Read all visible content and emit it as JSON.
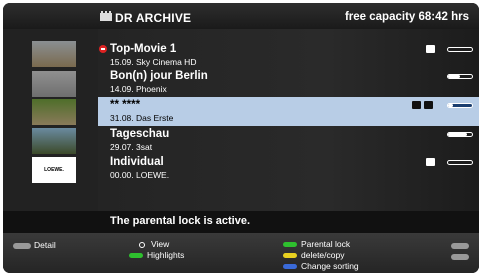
{
  "header": {
    "title": "DR ARCHIVE",
    "capacity": "free capacity 68:42 hrs"
  },
  "recordings": [
    {
      "title": "Top-Movie 1",
      "subtitle": "15.09.   Sky Cinema HD",
      "progress": 0.0,
      "selected": false
    },
    {
      "title": "Bon(n) jour Berlin",
      "subtitle": "14.09.   Phoenix",
      "progress": 0.5,
      "selected": false
    },
    {
      "title": "** ****",
      "subtitle": "31.08.   Das Erste",
      "progress": 0.2,
      "selected": true
    },
    {
      "title": "Tageschau",
      "subtitle": "29.07.   3sat",
      "progress": 0.8,
      "selected": false
    },
    {
      "title": "Individual",
      "subtitle": "00.00.   LOEWE.",
      "progress": 0.0,
      "selected": false
    }
  ],
  "thumbs": [
    {
      "label": "",
      "colors": [
        "#8a8f92",
        "#7a6a4e"
      ]
    },
    {
      "label": "",
      "colors": [
        "#909090",
        "#6e6e6e"
      ]
    },
    {
      "label": "",
      "colors": [
        "#4e6e2a",
        "#8a7a5a"
      ]
    },
    {
      "label": "",
      "colors": [
        "#6a8aa0",
        "#3c4a2a"
      ]
    },
    {
      "label": "LOEWE.",
      "colors": [
        "#ffffff",
        "#ffffff"
      ]
    }
  ],
  "message": "The parental lock is active.",
  "footer": {
    "detail": "Detail",
    "view": "View",
    "highlights": "Highlights",
    "parental_lock": "Parental lock",
    "delete_copy": "delete/copy",
    "change_sorting": "Change sorting"
  },
  "colors": {
    "selected_row": "#b8cde6",
    "green": "#2ec02e",
    "yellow": "#e8d020",
    "blue": "#3a6ad8"
  }
}
